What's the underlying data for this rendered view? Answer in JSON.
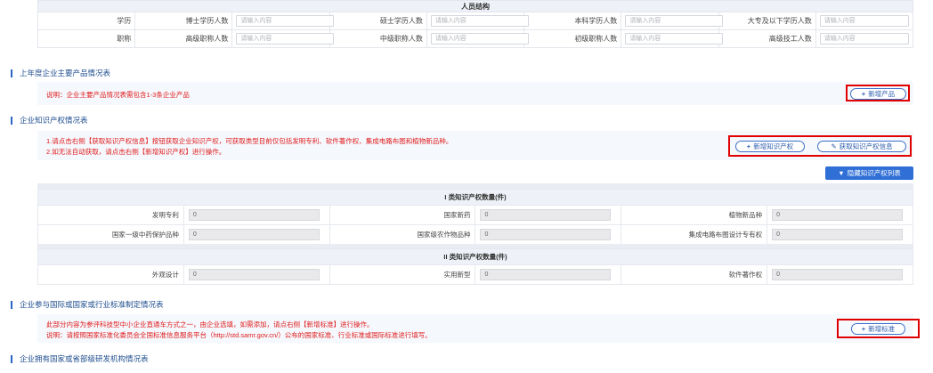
{
  "personnel": {
    "title": "人员结构",
    "placeholder": "请输入内容",
    "rows": [
      {
        "label": "学历",
        "cells": [
          "博士学历人数",
          "硕士学历人数",
          "本科学历人数",
          "大专及以下学历人数"
        ]
      },
      {
        "label": "职称",
        "cells": [
          "高级职称人数",
          "中级职称人数",
          "初级职称人数",
          "高级技工人数"
        ]
      }
    ]
  },
  "products": {
    "title": "上年度企业主要产品情况表",
    "note": "说明：企业主要产品情况表需包含1-3条企业产品",
    "add_button": "新增产品"
  },
  "ip": {
    "title": "企业知识产权情况表",
    "note_line1": "1.请点击右侧【获取知识产权信息】按钮获取企业知识产权，可获取类型目前仅包括发明专利、软件著作权、集成电路布图和植物新品种。",
    "note_line2": "2.如无法自动获取，请点击右侧【新增知识产权】进行操作。",
    "add_button": "新增知识产权",
    "fetch_button": "获取知识产权信息",
    "hide_button": "隐藏知识产权列表",
    "class1_title": "I 类知识产权数量(件)",
    "class1": [
      {
        "label": "发明专利",
        "value": "0"
      },
      {
        "label": "国家新药",
        "value": "0"
      },
      {
        "label": "植物新品种",
        "value": "0"
      },
      {
        "label": "国家一级中药保护品种",
        "value": "0"
      },
      {
        "label": "国家级农作物品种",
        "value": "0"
      },
      {
        "label": "集成电路布图设计专有权",
        "value": "0"
      }
    ],
    "class2_title": "II 类知识产权数量(件)",
    "class2": [
      {
        "label": "外观设计",
        "value": "0"
      },
      {
        "label": "实用新型",
        "value": "0"
      },
      {
        "label": "软件著作权",
        "value": "0"
      }
    ]
  },
  "standards": {
    "title": "企业参与国际或国家或行业标准制定情况表",
    "note_line1": "此部分内容为参评科技型中小企业直通车方式之一，由企业选填，如需添加，请点右侧【新增标准】进行操作。",
    "note_line2": "说明：请按照国家标准化委员会全国标准信息服务平台（http://std.samr.gov.cn/）公布的国家标准、行业标准或国际标准进行填写。",
    "add_button": "新增标准"
  },
  "rnd": {
    "title": "企业拥有国家或省部级研发机构情况表"
  }
}
